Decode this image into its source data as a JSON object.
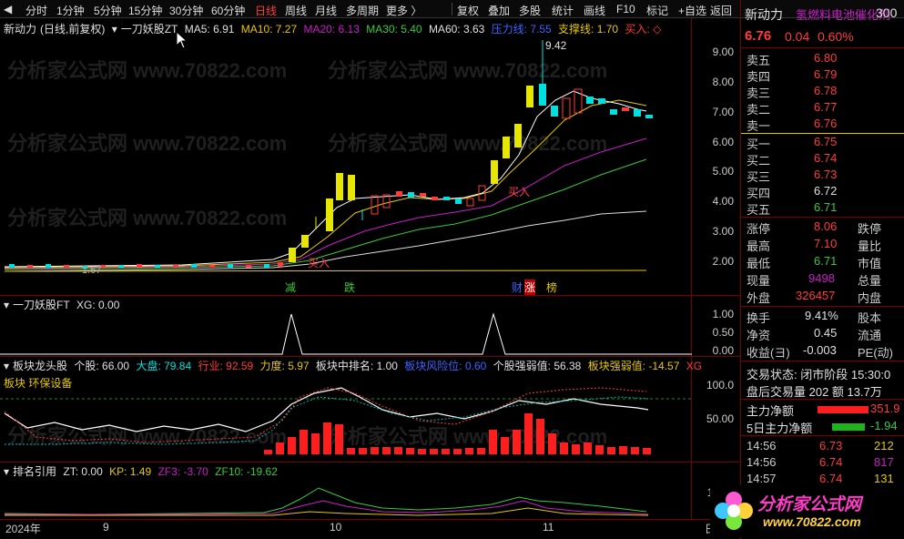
{
  "toolbar": {
    "left_items": [
      "分时",
      "1分钟",
      "5分钟",
      "15分钟",
      "30分钟",
      "60分钟",
      "日线",
      "周线",
      "月线",
      "多周期",
      "更多 〉"
    ],
    "active_item": "日线",
    "right_items": [
      "复权",
      "叠加",
      "多股",
      "统计",
      "画线",
      "F10",
      "标记",
      "+自选",
      "返回"
    ]
  },
  "main_chart": {
    "stock_name": "新动力",
    "period": "(日线,前复权)",
    "indicator": "一刀妖股ZT",
    "ma5": "MA5: 6.91",
    "ma10": "MA10: 7.27",
    "ma20": "MA20: 6.13",
    "ma30": "MA30: 5.40",
    "ma60": "MA60: 3.63",
    "pressure": "压力线: 7.55",
    "support": "支撑线: 1.70",
    "buy": "买入: ◇",
    "y_ticks": [
      "9.00",
      "8.00",
      "7.00",
      "6.00",
      "5.00",
      "4.00",
      "3.00",
      "2.00"
    ],
    "high_label": "9.42",
    "low_label": "1.67",
    "buy_mark": "买入",
    "buy_mark2": "买入",
    "events": [
      "减",
      "跌",
      "财",
      "涨",
      "榜"
    ],
    "colors": {
      "up": "#ff3c3c",
      "down": "#00e0e0",
      "yellow": "#e6e600"
    }
  },
  "panel2": {
    "title": "一刀妖股FT",
    "xg": "XG: 0.00",
    "y_ticks": [
      "1.00",
      "0.50",
      "0.00"
    ]
  },
  "panel3": {
    "title": "板块龙头股",
    "items": [
      "个股: 66.00",
      "大盘: 79.84",
      "行业: 92.59",
      "力度: 5.97",
      "板块中排名: 1.00",
      "板块风险位: 0.60",
      "个股强弱值: 56.38",
      "板块强弱值: -14.57",
      "XG"
    ],
    "sector": "板块 环保设备",
    "y_ticks": [
      "100.0",
      "50.00"
    ]
  },
  "panel4": {
    "title": "排名引用",
    "items": [
      "ZT: 0.00",
      "KP: 1.49",
      "ZF3: -3.70",
      "ZF10: -19.62"
    ],
    "y_tick": "10"
  },
  "x_axis": {
    "labels": [
      "2024年",
      "9",
      "10",
      "11"
    ],
    "right": "日"
  },
  "quote": {
    "name": "新动力",
    "code": "300",
    "concept": "氢燃料电池催化剂",
    "price": "6.76",
    "change": "0.04",
    "pct": "0.60%",
    "asks": [
      {
        "label": "卖五",
        "price": "6.80"
      },
      {
        "label": "卖四",
        "price": "6.79"
      },
      {
        "label": "卖三",
        "price": "6.78"
      },
      {
        "label": "卖二",
        "price": "6.77"
      },
      {
        "label": "卖一",
        "price": "6.76"
      }
    ],
    "bids": [
      {
        "label": "买一",
        "price": "6.75"
      },
      {
        "label": "买二",
        "price": "6.74"
      },
      {
        "label": "买三",
        "price": "6.73"
      },
      {
        "label": "买四",
        "price": "6.72"
      },
      {
        "label": "买五",
        "price": "6.71"
      }
    ],
    "stats": [
      {
        "k": "涨停",
        "v": "8.06",
        "k2": "跌停"
      },
      {
        "k": "最高",
        "v": "7.10",
        "k2": "量比"
      },
      {
        "k": "最低",
        "v": "6.71",
        "k2": "市值"
      },
      {
        "k": "现量",
        "v": "9498",
        "k2": "总量"
      },
      {
        "k": "外盘",
        "v": "326457",
        "k2": "内盘"
      },
      {
        "k": "换手",
        "v": "9.41%",
        "k2": "股本"
      },
      {
        "k": "净资",
        "v": "0.45",
        "k2": "流通"
      },
      {
        "k": "收益(ヨ)",
        "v": "-0.003",
        "k2": "PE(动)"
      }
    ],
    "status": "交易状态: 闭市阶段 15:30:0",
    "after": "盘后交易量 202 额 13.7万",
    "main_net": {
      "k": "主力净额",
      "v": "351.9"
    },
    "main_net5": {
      "k": "5日主力净额",
      "v": "-1.94"
    },
    "ticks": [
      {
        "t": "14:56",
        "p": "6.73",
        "v": "212"
      },
      {
        "t": "14:56",
        "p": "6.74",
        "v": "817"
      },
      {
        "t": "14:57",
        "p": "6.74",
        "v": "131"
      }
    ],
    "logo": "分析家公式网",
    "logo_url": "www.70822.com"
  },
  "watermark": "分析家公式网 www.70822.com"
}
